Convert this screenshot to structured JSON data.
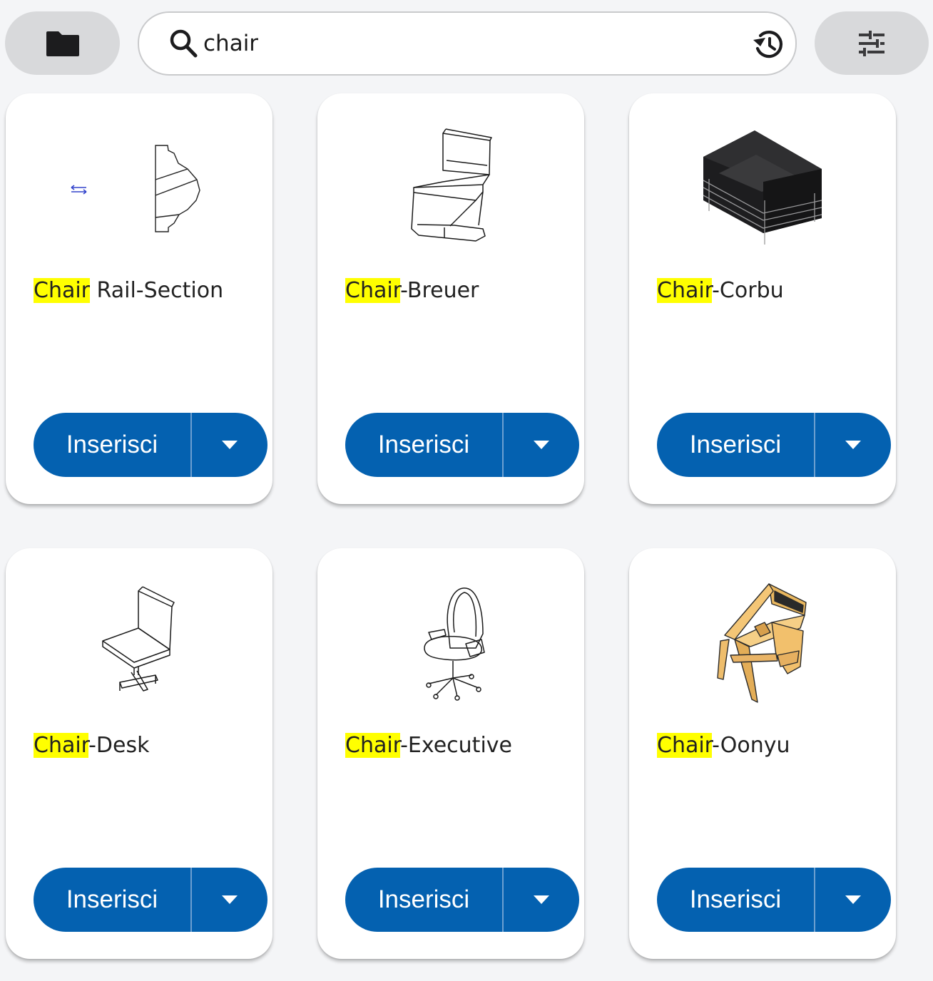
{
  "toolbar": {
    "folder_icon": "folder-icon",
    "filter_icon": "tune-sliders-icon"
  },
  "search": {
    "value": "chair",
    "search_icon": "search-icon",
    "history_icon": "history-icon"
  },
  "cards": [
    {
      "highlight": "Chair",
      "rest": " Rail-Section",
      "insert_label": "Inserisci",
      "dropdown_icon": "caret-down-icon",
      "thumbnail": "chair-rail-section-drawing"
    },
    {
      "highlight": "Chair",
      "rest": "-Breuer",
      "insert_label": "Inserisci",
      "dropdown_icon": "caret-down-icon",
      "thumbnail": "cantilever-chair-drawing"
    },
    {
      "highlight": "Chair",
      "rest": "-Corbu",
      "insert_label": "Inserisci",
      "dropdown_icon": "caret-down-icon",
      "thumbnail": "cube-armchair-render"
    },
    {
      "highlight": "Chair",
      "rest": "-Desk",
      "insert_label": "Inserisci",
      "dropdown_icon": "caret-down-icon",
      "thumbnail": "desk-chair-drawing"
    },
    {
      "highlight": "Chair",
      "rest": "-Executive",
      "insert_label": "Inserisci",
      "dropdown_icon": "caret-down-icon",
      "thumbnail": "executive-office-chair-drawing"
    },
    {
      "highlight": "Chair",
      "rest": "-Oonyu",
      "insert_label": "Inserisci",
      "dropdown_icon": "caret-down-icon",
      "thumbnail": "wooden-chair-render"
    }
  ],
  "colors": {
    "background": "#f4f5f7",
    "button_primary": "#0461b0",
    "highlight": "#ffff00",
    "pill_gray": "#d8d9db"
  }
}
